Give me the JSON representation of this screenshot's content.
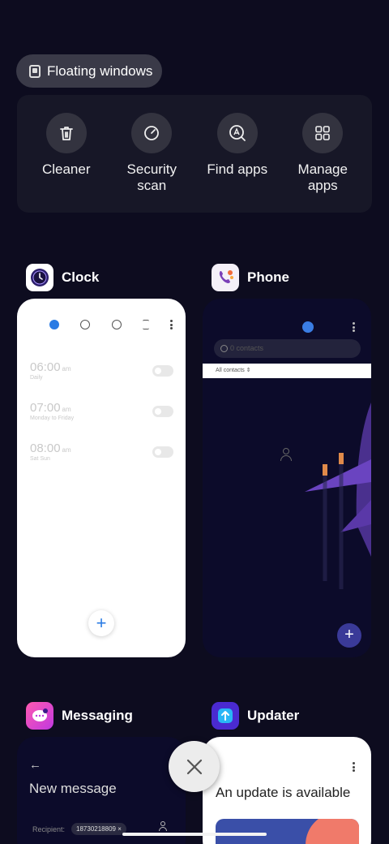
{
  "floating_windows": {
    "label": "Floating windows",
    "icon": "floating-window-icon"
  },
  "quick_actions": [
    {
      "name": "cleaner",
      "label": "Cleaner",
      "icon": "trash-icon"
    },
    {
      "name": "security-scan",
      "label": "Security\nscan",
      "icon": "scan-icon"
    },
    {
      "name": "find-apps",
      "label": "Find apps",
      "icon": "search-app-icon"
    },
    {
      "name": "manage-apps",
      "label": "Manage\napps",
      "icon": "grid-icon"
    }
  ],
  "apps": {
    "clock": {
      "title": "Clock",
      "alarms": [
        {
          "time": "06:00",
          "ampm": "am",
          "repeat": "Daily",
          "enabled": false
        },
        {
          "time": "07:00",
          "ampm": "am",
          "repeat": "Monday to Friday",
          "enabled": false
        },
        {
          "time": "08:00",
          "ampm": "am",
          "repeat": "Sat Sun",
          "enabled": false
        }
      ],
      "fab": "+"
    },
    "phone": {
      "title": "Phone",
      "search_placeholder": "0 contacts",
      "filter_label": "All contacts",
      "fab": "+"
    },
    "messaging": {
      "title": "Messaging",
      "back": "←",
      "heading": "New message",
      "recipient_label": "Recipient:",
      "recipient_value": "18730218809 ×"
    },
    "updater": {
      "title": "Updater",
      "heading": "An update is available"
    }
  },
  "close_all": {
    "icon": "close-icon"
  },
  "colors": {
    "background": "#0d0c1f",
    "panel": "#171727",
    "accent": "#2a7be4"
  }
}
